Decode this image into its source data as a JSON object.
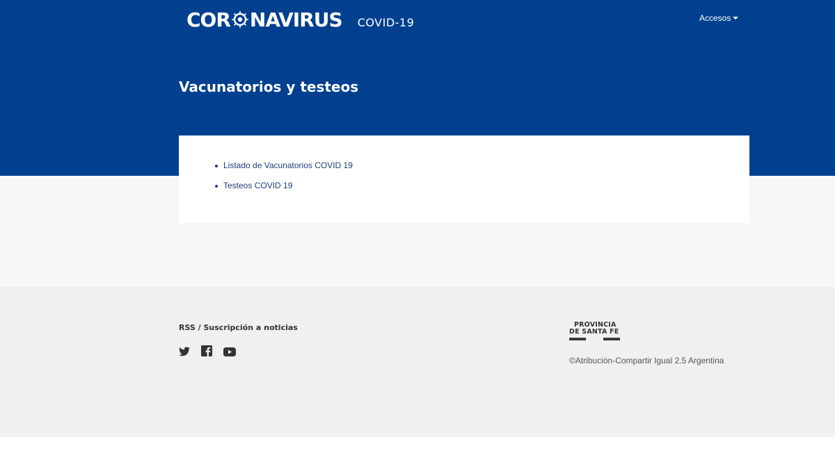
{
  "header": {
    "logo_left": "COR",
    "logo_right": "NAVIRUS",
    "subtitle": "COVID-19",
    "menu_label": "Accesos"
  },
  "page": {
    "title": "Vacunatorios y testeos"
  },
  "links": [
    {
      "label": "Listado de Vacunatorios COVID 19"
    },
    {
      "label": "Testeos COVID 19"
    }
  ],
  "footer": {
    "rss_title": "RSS / Suscripción a noticias",
    "social_icons": [
      "twitter-icon",
      "facebook-icon",
      "youtube-icon"
    ],
    "logo_line1": "PROVINCIA",
    "logo_line2": "DE SANTA FE",
    "license": "©Atribución-Compartir Igual 2.5 Argentina"
  },
  "colors": {
    "header_bg": "#00408f",
    "page_bg": "#f7f7f7",
    "footer_bg": "#f0f0f0",
    "link": "#1d3d7a"
  }
}
